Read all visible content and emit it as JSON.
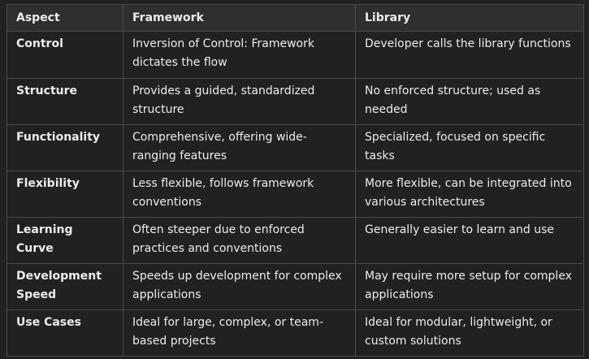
{
  "table": {
    "headers": [
      "Aspect",
      "Framework",
      "Library"
    ],
    "rows": [
      [
        "Control",
        "Inversion of Control: Framework dictates the flow",
        "Developer calls the library functions"
      ],
      [
        "Structure",
        "Provides a guided, standardized structure",
        "No enforced structure; used as needed"
      ],
      [
        "Functionality",
        "Comprehensive, offering wide-ranging features",
        "Specialized, focused on specific tasks"
      ],
      [
        "Flexibility",
        "Less flexible, follows framework conventions",
        "More flexible, can be integrated into various architectures"
      ],
      [
        "Learning Curve",
        "Often steeper due to enforced practices and conventions",
        "Generally easier to learn and use"
      ],
      [
        "Development Speed",
        "Speeds up development for complex applications",
        "May require more setup for complex applications"
      ],
      [
        "Use Cases",
        "Ideal for large, complex, or team-based projects",
        "Ideal for modular, lightweight, or custom solutions"
      ]
    ]
  }
}
